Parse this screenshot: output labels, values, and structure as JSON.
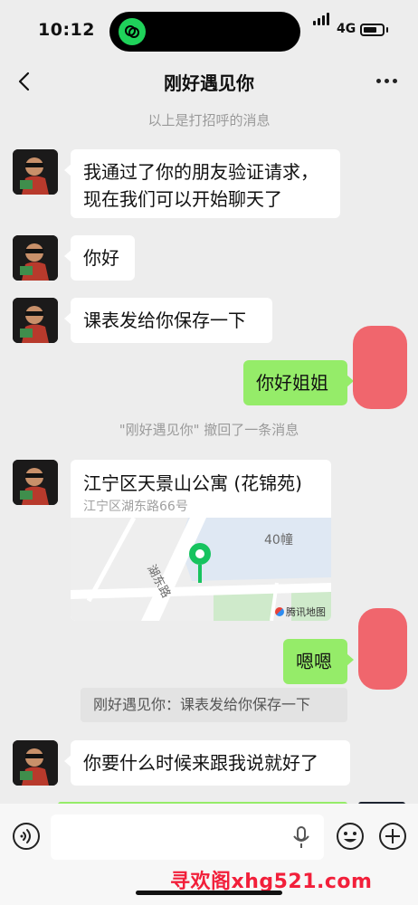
{
  "status_bar": {
    "time": "10:12",
    "network": "4G"
  },
  "header": {
    "title": "刚好遇见你"
  },
  "colors": {
    "background": "#ededed",
    "incoming_bubble": "#ffffff",
    "outgoing_bubble": "#95ec69",
    "watermark": "#f21f3a",
    "map_pin": "#16c35f"
  },
  "messages": {
    "system_greeting": "以上是打招呼的消息",
    "m1": "我通过了你的朋友验证请求，现在我们可以开始聊天了",
    "m2": "你好",
    "m3": "课表发给你保存一下",
    "m4": "你好姐姐",
    "system_recall": "\"刚好遇见你\" 撤回了一条消息",
    "location": {
      "title": "江宁区天景山公寓 (花锦苑)",
      "address": "江宁区湖东路66号",
      "map_building_label": "40幢",
      "map_road_label": "湖东路",
      "map_provider": "腾讯地图"
    },
    "m5": "嗯嗯",
    "quote": "刚好遇见你：课表发给你保存一下",
    "m6": "你要什么时候来跟我说就好了"
  },
  "input_bar": {
    "placeholder": ""
  },
  "watermark": "寻欢阁xhg521.com"
}
